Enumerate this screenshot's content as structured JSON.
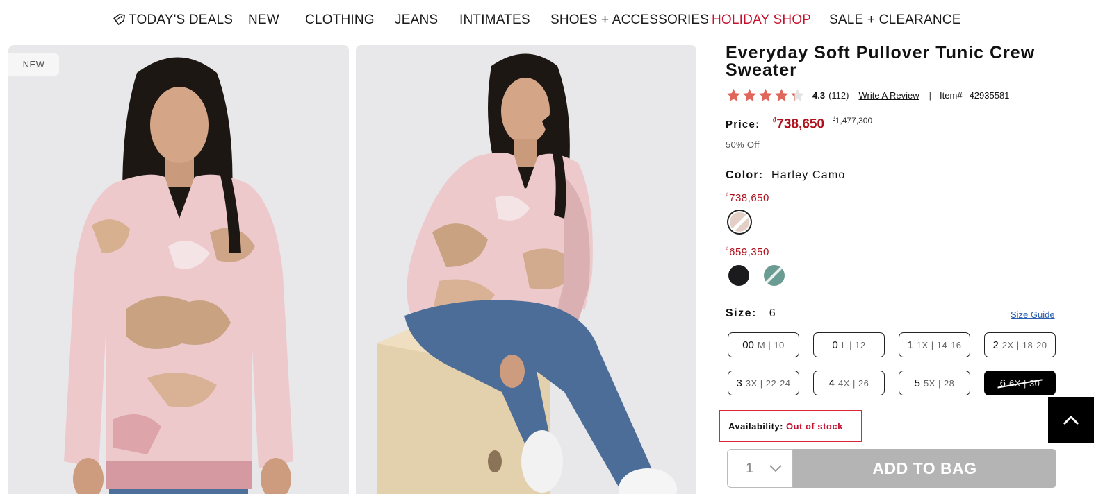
{
  "nav": {
    "items": [
      {
        "label": "TODAY'S DEALS"
      },
      {
        "label": "NEW"
      },
      {
        "label": "CLOTHING"
      },
      {
        "label": "JEANS"
      },
      {
        "label": "INTIMATES"
      },
      {
        "label": "SHOES + ACCESSORIES"
      },
      {
        "label": "HOLIDAY SHOP"
      },
      {
        "label": "SALE + CLEARANCE"
      }
    ],
    "deals_icon": "tag-icon",
    "holiday_color": "#c4122f"
  },
  "gallery": {
    "badge": "NEW"
  },
  "product": {
    "title": "Everyday Soft Pullover Tunic Crew Sweater",
    "rating": "4.3",
    "rating_value": 4.3,
    "review_count": "(112)",
    "write_review": "Write A Review",
    "separator": "|",
    "item_label": "Item#",
    "item_number": "42935581",
    "price_label": "Price:",
    "currency": "₫",
    "price_now": "738,650",
    "price_was": "1,477,300",
    "discount": "50% Off",
    "color_label": "Color:",
    "color_value": "Harley Camo",
    "variant_groups": [
      {
        "price": "738,650",
        "swatches": [
          "camo-light"
        ]
      },
      {
        "price": "659,350",
        "swatches": [
          "black",
          "teal-camo"
        ]
      }
    ],
    "size_label": "Size:",
    "size_value": "6",
    "size_guide": "Size Guide",
    "sizes": [
      {
        "main": "00",
        "alt": "M | 10"
      },
      {
        "main": "0",
        "alt": "L | 12"
      },
      {
        "main": "1",
        "alt": "1X | 14-16"
      },
      {
        "main": "2",
        "alt": "2X | 18-20"
      },
      {
        "main": "3",
        "alt": "3X | 22-24"
      },
      {
        "main": "4",
        "alt": "4X | 26"
      },
      {
        "main": "5",
        "alt": "5X | 28"
      },
      {
        "main": "6",
        "alt": "6X | 30"
      }
    ],
    "availability_label": "Availability:",
    "availability_value": "Out of stock",
    "quantity": "1",
    "add_to_bag": "ADD TO BAG",
    "price_color": "#b0101c"
  }
}
